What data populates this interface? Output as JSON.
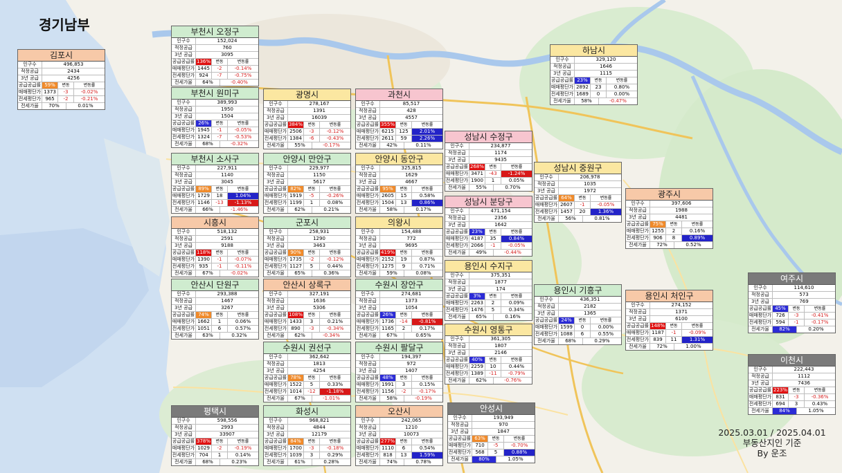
{
  "page_title": "경기남부",
  "footer": {
    "date_range": "2025.03.01 / 2025.04.01",
    "basis": "부동산지인 기준",
    "author": "By 운조"
  },
  "theme": {
    "title_green": "#cfeccf",
    "title_orange": "#f7c9a8",
    "title_yellow": "#fbe7a1",
    "title_pink": "#f7c5cf",
    "title_gray": "#7a7a7a",
    "pos_blue": "#2323c8",
    "neg_red": "#d81818",
    "ratio_orange": "#f08a2a"
  },
  "row_labels": {
    "population": "인구수",
    "proper_supply": "적정공급",
    "supply_3y": "3년 공급",
    "ratio": "공급공급률",
    "change": "변동",
    "change_rate": "변동률",
    "sale_price": "매매평단가",
    "jeonse_price": "전세평단가",
    "jeonse_ratio": "전세가율"
  },
  "regions": [
    {
      "id": "gimpo",
      "name": "김포시",
      "color": "orange",
      "population": "496,853",
      "proper": "2434",
      "supply3": "4256",
      "ratio": "59%",
      "ratio_style": "org",
      "sale": "1373",
      "sale_chg": "-3",
      "sale_rate": "-0.02%",
      "jeonse": "965",
      "jeonse_chg": "-2",
      "jeonse_rate": "-0.21%",
      "jr": "70%",
      "jr_chg": "0.01%"
    },
    {
      "id": "bucheon-ojeong",
      "name": "부천시 오정구",
      "color": "green",
      "population": "152,024",
      "proper": "760",
      "supply3": "3095",
      "ratio": "136%",
      "ratio_style": "red",
      "sale": "1445",
      "sale_chg": "-2",
      "sale_rate": "-0.14%",
      "jeonse": "924",
      "jeonse_chg": "-7",
      "jeonse_rate": "-0.75%",
      "jr": "64%",
      "jr_chg": "-0.40%"
    },
    {
      "id": "bucheon-wonmi",
      "name": "부천시 원미구",
      "color": "green",
      "population": "389,993",
      "proper": "1950",
      "supply3": "1504",
      "ratio": "26%",
      "ratio_style": "blu",
      "sale": "1945",
      "sale_chg": "-1",
      "sale_rate": "-0.05%",
      "jeonse": "1324",
      "jeonse_chg": "-7",
      "jeonse_rate": "-0.53%",
      "jr": "68%",
      "jr_chg": "-0.32%"
    },
    {
      "id": "gwangmyeong",
      "name": "광명시",
      "color": "yellow",
      "population": "278,167",
      "proper": "1391",
      "supply3": "16039",
      "ratio": "384%",
      "ratio_style": "red",
      "sale": "2506",
      "sale_chg": "-3",
      "sale_rate": "-0.12%",
      "jeonse": "1384",
      "jeonse_chg": "-6",
      "jeonse_rate": "-0.43%",
      "jr": "55%",
      "jr_chg": "-0.17%"
    },
    {
      "id": "gwacheon",
      "name": "과천시",
      "color": "pink",
      "population": "85,517",
      "proper": "428",
      "supply3": "4557",
      "ratio": "355%",
      "ratio_style": "red",
      "sale": "6215",
      "sale_chg": "125",
      "sale_rate": "2.01%",
      "jeonse": "2611",
      "jeonse_chg": "59",
      "jeonse_rate": "2.26%",
      "jr": "42%",
      "jr_chg": "0.11%",
      "sale_style": "posb",
      "jeonse_style": "posb"
    },
    {
      "id": "bucheon-sosa",
      "name": "부천시 소사구",
      "color": "green",
      "population": "227,911",
      "proper": "1140",
      "supply3": "3045",
      "ratio": "89%",
      "ratio_style": "org",
      "sale": "1729",
      "sale_chg": "18",
      "sale_rate": "1.04%",
      "jeonse": "1146",
      "jeonse_chg": "-13",
      "jeonse_rate": "-1.13%",
      "jr": "66%",
      "jr_chg": "-1.46%",
      "sale_style": "posb",
      "jeonse_style": "negb"
    },
    {
      "id": "anyang-manan",
      "name": "안양시 만안구",
      "color": "green",
      "population": "229,977",
      "proper": "1150",
      "supply3": "5617",
      "ratio": "82%",
      "ratio_style": "org",
      "sale": "1919",
      "sale_chg": "-5",
      "sale_rate": "-0.26%",
      "jeonse": "1199",
      "jeonse_chg": "1",
      "jeonse_rate": "0.08%",
      "jr": "62%",
      "jr_chg": "0.21%"
    },
    {
      "id": "anyang-dongan",
      "name": "안양시 동안구",
      "color": "yellow",
      "population": "325,815",
      "proper": "1629",
      "supply3": "4667",
      "ratio": "95%",
      "ratio_style": "org",
      "sale": "2605",
      "sale_chg": "15",
      "sale_rate": "0.58%",
      "jeonse": "1504",
      "jeonse_chg": "13",
      "jeonse_rate": "0.86%",
      "jr": "58%",
      "jr_chg": "0.17%",
      "jeonse_style": "posb"
    },
    {
      "id": "seongnam-sujeong",
      "name": "성남시 수정구",
      "color": "pink",
      "population": "234,877",
      "proper": "1174",
      "supply3": "9435",
      "ratio": "268%",
      "ratio_style": "red",
      "sale": "3471",
      "sale_chg": "-43",
      "sale_rate": "-1.24%",
      "jeonse": "1900",
      "jeonse_chg": "1",
      "jeonse_rate": "0.05%",
      "jr": "55%",
      "jr_chg": "0.70%",
      "sale_style": "negb"
    },
    {
      "id": "hanam",
      "name": "하남시",
      "color": "yellow",
      "population": "329,120",
      "proper": "1646",
      "supply3": "1115",
      "ratio": "23%",
      "ratio_style": "blu",
      "sale": "2892",
      "sale_chg": "23",
      "sale_rate": "0.80%",
      "jeonse": "1689",
      "jeonse_chg": "0",
      "jeonse_rate": "0.00%",
      "jr": "58%",
      "jr_chg": "-0.47%"
    },
    {
      "id": "seongnam-jungwon",
      "name": "성남시 중원구",
      "color": "yellow",
      "population": "206,978",
      "proper": "1035",
      "supply3": "1972",
      "ratio": "64%",
      "ratio_style": "org",
      "sale": "2607",
      "sale_chg": "-1",
      "sale_rate": "-0.05%",
      "jeonse": "1457",
      "jeonse_chg": "20",
      "jeonse_rate": "1.36%",
      "jr": "56%",
      "jr_chg": "0.81%",
      "jeonse_style": "posb"
    },
    {
      "id": "siheung",
      "name": "시흥시",
      "color": "orange",
      "population": "518,132",
      "proper": "2591",
      "supply3": "9188",
      "ratio": "118%",
      "ratio_style": "red",
      "sale": "1390",
      "sale_chg": "-1",
      "sale_rate": "-0.07%",
      "jeonse": "935",
      "jeonse_chg": "-1",
      "jeonse_rate": "-0.11%",
      "jr": "67%",
      "jr_chg": "-0.02%"
    },
    {
      "id": "gunpo",
      "name": "군포시",
      "color": "green",
      "population": "258,931",
      "proper": "1290",
      "supply3": "3463",
      "ratio": "90%",
      "ratio_style": "org",
      "sale": "1735",
      "sale_chg": "-2",
      "sale_rate": "-0.12%",
      "jeonse": "1127",
      "jeonse_chg": "5",
      "jeonse_rate": "0.44%",
      "jr": "65%",
      "jr_chg": "0.36%"
    },
    {
      "id": "uiwang",
      "name": "의왕시",
      "color": "yellow",
      "population": "154,488",
      "proper": "772",
      "supply3": "9695",
      "ratio": "419%",
      "ratio_style": "red",
      "sale": "2152",
      "sale_chg": "19",
      "sale_rate": "0.87%",
      "jeonse": "1275",
      "jeonse_chg": "9",
      "jeonse_rate": "0.71%",
      "jr": "59%",
      "jr_chg": "0.08%"
    },
    {
      "id": "seongnam-bundang",
      "name": "성남시 분당구",
      "color": "pink",
      "population": "471,154",
      "proper": "2356",
      "supply3": "1642",
      "ratio": "23%",
      "ratio_style": "blu",
      "sale": "4187",
      "sale_chg": "35",
      "sale_rate": "0.84%",
      "jeonse": "2066",
      "jeonse_chg": "-1",
      "jeonse_rate": "-0.05%",
      "jr": "49%",
      "jr_chg": "-0.44%",
      "sale_style": "posb"
    },
    {
      "id": "gwangju",
      "name": "광주시",
      "color": "orange",
      "population": "397,606",
      "proper": "1988",
      "supply3": "4481",
      "ratio": "75%",
      "ratio_style": "org",
      "sale": "1255",
      "sale_chg": "2",
      "sale_rate": "0.16%",
      "jeonse": "906",
      "jeonse_chg": "8",
      "jeonse_rate": "0.89%",
      "jr": "72%",
      "jr_chg": "0.52%",
      "jeonse_style": "posb"
    },
    {
      "id": "ansan-danwon",
      "name": "안산시 단원구",
      "color": "green",
      "population": "293,388",
      "proper": "1467",
      "supply3": "3267",
      "ratio": "74%",
      "ratio_style": "org",
      "sale": "1662",
      "sale_chg": "1",
      "sale_rate": "0.06%",
      "jeonse": "1051",
      "jeonse_chg": "6",
      "jeonse_rate": "0.57%",
      "jr": "63%",
      "jr_chg": "0.32%"
    },
    {
      "id": "ansan-sangnok",
      "name": "안산시 상록구",
      "color": "orange",
      "population": "327,191",
      "proper": "1636",
      "supply3": "5306",
      "ratio": "108%",
      "ratio_style": "red",
      "sale": "1433",
      "sale_chg": "3",
      "sale_rate": "0.21%",
      "jeonse": "890",
      "jeonse_chg": "-3",
      "jeonse_rate": "-0.34%",
      "jr": "62%",
      "jr_chg": "-0.34%"
    },
    {
      "id": "suwon-jangan",
      "name": "수원시 장안구",
      "color": "green",
      "population": "274,681",
      "proper": "1373",
      "supply3": "1054",
      "ratio": "26%",
      "ratio_style": "blu",
      "sale": "1736",
      "sale_chg": "-14",
      "sale_rate": "-0.81%",
      "jeonse": "1165",
      "jeonse_chg": "2",
      "jeonse_rate": "0.17%",
      "jr": "67%",
      "jr_chg": "0.65%",
      "sale_style": "negb"
    },
    {
      "id": "yongin-suji",
      "name": "용인시 수지구",
      "color": "yellow",
      "population": "375,351",
      "proper": "1877",
      "supply3": "174",
      "ratio": "3%",
      "ratio_style": "blu",
      "sale": "2263",
      "sale_chg": "2",
      "sale_rate": "0.09%",
      "jeonse": "1476",
      "jeonse_chg": "5",
      "jeonse_rate": "0.34%",
      "jr": "65%",
      "jr_chg": "0.16%"
    },
    {
      "id": "yongin-giheung",
      "name": "용인시 기흥구",
      "color": "green",
      "population": "436,351",
      "proper": "2182",
      "supply3": "1365",
      "ratio": "24%",
      "ratio_style": "blu",
      "sale": "1599",
      "sale_chg": "0",
      "sale_rate": "0.00%",
      "jeonse": "1088",
      "jeonse_chg": "6",
      "jeonse_rate": "0.55%",
      "jr": "68%",
      "jr_chg": "0.29%"
    },
    {
      "id": "yongin-cheoin",
      "name": "용인시 처인구",
      "color": "orange",
      "population": "274,152",
      "proper": "1371",
      "supply3": "6100",
      "ratio": "148%",
      "ratio_style": "red",
      "sale": "1187",
      "sale_chg": "-1",
      "sale_rate": "-0.09%",
      "jeonse": "839",
      "jeonse_chg": "11",
      "jeonse_rate": "1.31%",
      "jr": "72%",
      "jr_chg": "1.00%",
      "jeonse_style": "posb"
    },
    {
      "id": "yeoju",
      "name": "여주시",
      "color": "gray",
      "population": "114,610",
      "proper": "573",
      "supply3": "769",
      "ratio": "45%",
      "ratio_style": "blu",
      "sale": "726",
      "sale_chg": "-3",
      "sale_rate": "-0.41%",
      "jeonse": "594",
      "jeonse_chg": "-1",
      "jeonse_rate": "-0.17%",
      "jr": "82%",
      "jr_chg": "0.20%",
      "jr_style": "blu"
    },
    {
      "id": "suwon-gwonseon",
      "name": "수원시 권선구",
      "color": "green",
      "population": "362,642",
      "proper": "1813",
      "supply3": "4254",
      "ratio": "78%",
      "ratio_style": "org",
      "sale": "1522",
      "sale_chg": "5",
      "sale_rate": "0.33%",
      "jeonse": "1014",
      "jeonse_chg": "-12",
      "jeonse_rate": "-1.18%",
      "jr": "67%",
      "jr_chg": "-1.01%",
      "jeonse_style": "negb"
    },
    {
      "id": "suwon-paldal",
      "name": "수원시 팔달구",
      "color": "green",
      "population": "194,397",
      "proper": "972",
      "supply3": "1407",
      "ratio": "48%",
      "ratio_style": "blu",
      "sale": "1991",
      "sale_chg": "3",
      "sale_rate": "0.15%",
      "jeonse": "1156",
      "jeonse_chg": "-2",
      "jeonse_rate": "-0.17%",
      "jr": "58%",
      "jr_chg": "-0.19%"
    },
    {
      "id": "suwon-yeongtong",
      "name": "수원시 영통구",
      "color": "yellow",
      "population": "361,305",
      "proper": "1807",
      "supply3": "2146",
      "ratio": "40%",
      "ratio_style": "blu",
      "sale": "2259",
      "sale_chg": "10",
      "sale_rate": "0.44%",
      "jeonse": "1389",
      "jeonse_chg": "-11",
      "jeonse_rate": "-0.79%",
      "jr": "62%",
      "jr_chg": "-0.76%"
    },
    {
      "id": "icheon",
      "name": "이천시",
      "color": "gray",
      "population": "222,443",
      "proper": "1112",
      "supply3": "7436",
      "ratio": "223%",
      "ratio_style": "red",
      "sale": "831",
      "sale_chg": "-3",
      "sale_rate": "-0.36%",
      "jeonse": "694",
      "jeonse_chg": "3",
      "jeonse_rate": "0.43%",
      "jr": "84%",
      "jr_chg": "1.05%",
      "jr_style": "blu"
    },
    {
      "id": "pyeongtaek",
      "name": "평택시",
      "color": "gray",
      "population": "598,556",
      "proper": "2993",
      "supply3": "33907",
      "ratio": "378%",
      "ratio_style": "red",
      "sale": "1029",
      "sale_chg": "-2",
      "sale_rate": "-0.19%",
      "jeonse": "704",
      "jeonse_chg": "1",
      "jeonse_rate": "0.14%",
      "jr": "68%",
      "jr_chg": "0.23%"
    },
    {
      "id": "hwaseong",
      "name": "화성시",
      "color": "green",
      "population": "968,821",
      "proper": "4844",
      "supply3": "12179",
      "ratio": "84%",
      "ratio_style": "org",
      "sale": "1700",
      "sale_chg": "-3",
      "sale_rate": "-0.18%",
      "jeonse": "1039",
      "jeonse_chg": "3",
      "jeonse_rate": "0.29%",
      "jr": "61%",
      "jr_chg": "0.28%"
    },
    {
      "id": "osan",
      "name": "오산시",
      "color": "orange",
      "population": "242,065",
      "proper": "1210",
      "supply3": "10073",
      "ratio": "277%",
      "ratio_style": "red",
      "sale": "1110",
      "sale_chg": "6",
      "sale_rate": "0.54%",
      "jeonse": "818",
      "jeonse_chg": "13",
      "jeonse_rate": "1.59%",
      "jr": "74%",
      "jr_chg": "0.78%",
      "jeonse_style": "posb"
    },
    {
      "id": "anseong",
      "name": "안성시",
      "color": "gray",
      "population": "193,949",
      "proper": "970",
      "supply3": "1847",
      "ratio": "63%",
      "ratio_style": "org",
      "sale": "710",
      "sale_chg": "-5",
      "sale_rate": "-0.70%",
      "jeonse": "568",
      "jeonse_chg": "5",
      "jeonse_rate": "0.88%",
      "jr": "80%",
      "jr_chg": "1.05%",
      "jr_style": "blu",
      "jeonse_style": "posb"
    }
  ]
}
